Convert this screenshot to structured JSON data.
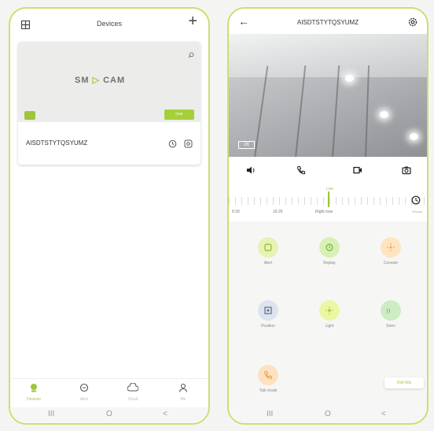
{
  "left": {
    "header": {
      "title": "Devices",
      "add_label": "+"
    },
    "device_card": {
      "logo_part1": "SM",
      "logo_part2": "CAM",
      "view_label": "Live",
      "device_id": "AISDTSTYTQSYUMZ"
    },
    "tabs": [
      {
        "label": "Devices"
      },
      {
        "label": "Alert"
      },
      {
        "label": "Cloud"
      },
      {
        "label": "Me"
      }
    ]
  },
  "right": {
    "header": {
      "back_label": "←",
      "title": "AISDTSTYTQSYUMZ"
    },
    "video": {
      "resolution": "2K"
    },
    "timeline": {
      "live_label": "Live",
      "times": [
        "6:30",
        "16:25",
        "Right now"
      ],
      "history_label": "Replay"
    },
    "features": [
      {
        "label": "Alert"
      },
      {
        "label": "Replay"
      },
      {
        "label": "Console"
      },
      {
        "label": "Position"
      },
      {
        "label": "Light"
      },
      {
        "label": "Siren"
      },
      {
        "label": "Talk mode"
      }
    ],
    "toast": "Roll 60s"
  },
  "system_nav": {
    "recent": "III",
    "home": "O",
    "back": "<"
  },
  "colors": {
    "accent": "#9dc63c",
    "frame": "#c6e26f"
  }
}
